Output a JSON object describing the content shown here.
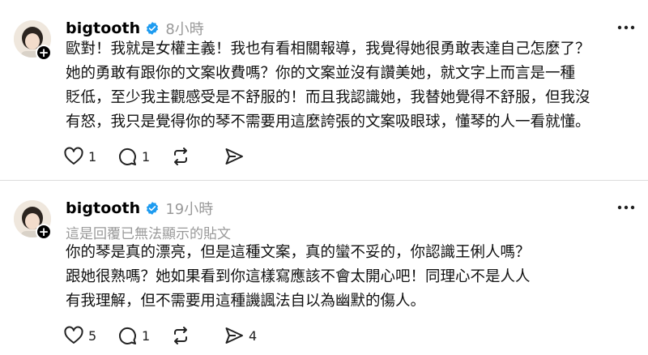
{
  "posts": [
    {
      "username": "bigtooth",
      "time": "8小時",
      "reply_note": "",
      "lines": [
        "歐對！我就是女權主義！我也有看相關報導，我覺得她很勇敢表達自己怎麼了？",
        "她的勇敢有跟你的文案收費嗎？你的文案並沒有讚美她，就文字上而言是一種",
        "貶低，至少我主觀感受是不舒服的！而且我認識她，我替她覺得不舒服，但我沒",
        "有怒，我只是覺得你的琴不需要用這麼誇張的文案吸眼球，懂琴的人一看就懂。"
      ],
      "likes": "1",
      "comments": "1",
      "reposts": "",
      "shares": ""
    },
    {
      "username": "bigtooth",
      "time": "19小時",
      "reply_note": "這是回覆已無法顯示的貼文",
      "lines": [
        "你的琴是真的漂亮，但是這種文案，真的蠻不妥的，你認識王俐人嗎？",
        "跟她很熟嗎？她如果看到你這樣寫應該不會太開心吧！同理心不是人人",
        "有我理解，但不需要用這種譏諷法自以為幽默的傷人。"
      ],
      "likes": "5",
      "comments": "1",
      "reposts": "",
      "shares": "4"
    }
  ],
  "icons": {
    "verified": "verified-badge-icon",
    "more": "more-options-icon",
    "like": "heart-icon",
    "comment": "comment-bubble-icon",
    "repost": "repost-icon",
    "share": "send-icon",
    "follow": "plus-icon"
  },
  "colors": {
    "verified": "#1d9bf0",
    "muted": "#999999",
    "divider": "#dcdcdc"
  }
}
